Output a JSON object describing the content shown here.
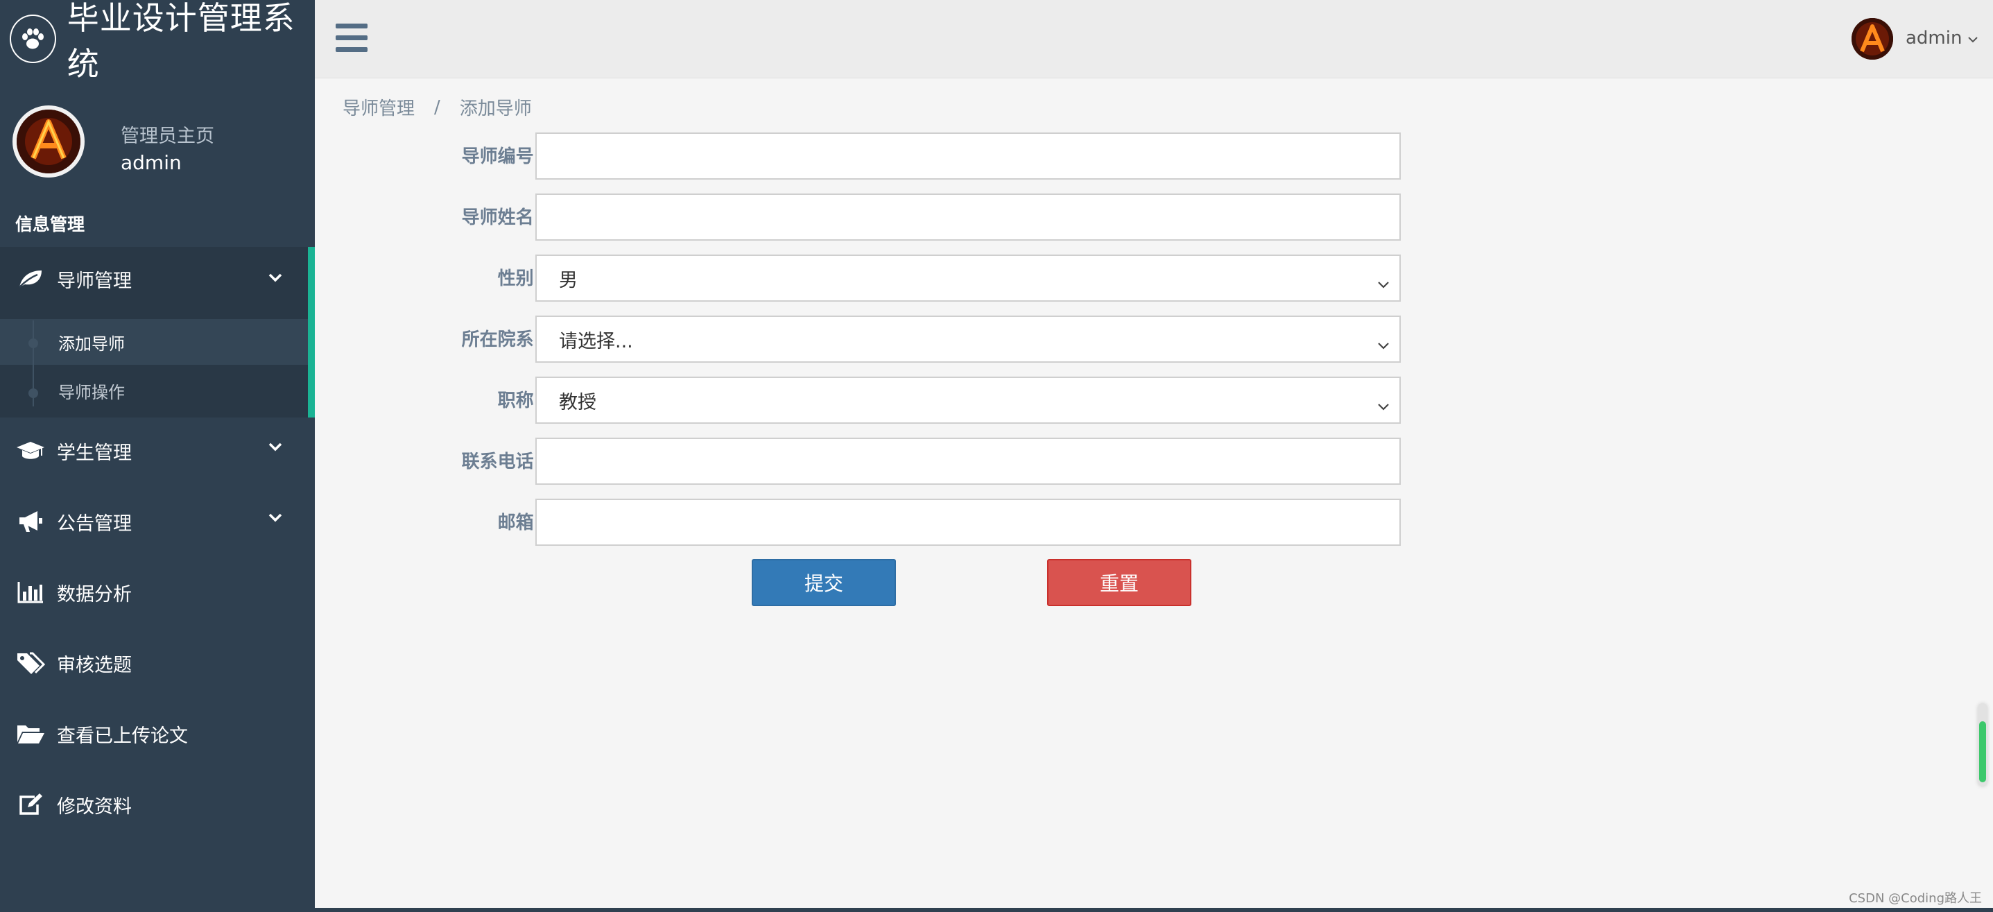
{
  "brand": {
    "title": "毕业设计管理系统",
    "logo_icon": "paw-icon"
  },
  "profile": {
    "role": "管理员主页",
    "name": "admin"
  },
  "sidebar": {
    "section_title": "信息管理",
    "items": [
      {
        "label": "导师管理",
        "icon": "leaf-icon",
        "expanded": true
      },
      {
        "label": "学生管理",
        "icon": "graduation-cap-icon",
        "expanded": false
      },
      {
        "label": "公告管理",
        "icon": "megaphone-icon",
        "expanded": false
      },
      {
        "label": "数据分析",
        "icon": "bar-chart-icon"
      },
      {
        "label": "审核选题",
        "icon": "tags-icon"
      },
      {
        "label": "查看已上传论文",
        "icon": "folder-open-icon"
      },
      {
        "label": "修改资料",
        "icon": "edit-icon"
      }
    ],
    "submenu": [
      {
        "label": "添加导师",
        "active": true
      },
      {
        "label": "导师操作",
        "active": false
      }
    ],
    "accent": "#1ab394",
    "background": "#2f4050"
  },
  "topbar": {
    "menu_icon": "hamburger-icon",
    "user": "admin"
  },
  "breadcrumb": {
    "parent": "导师管理",
    "separator": "/",
    "current": "添加导师"
  },
  "form": {
    "teacher_id": {
      "label": "导师编号:",
      "value": ""
    },
    "teacher_name": {
      "label": "导师姓名:",
      "value": ""
    },
    "gender": {
      "label": "性别:",
      "selected": "男"
    },
    "department": {
      "label": "所在院系:",
      "selected": "请选择..."
    },
    "title": {
      "label": "职称:",
      "selected": "教授"
    },
    "phone": {
      "label": "联系电话:",
      "value": ""
    },
    "email": {
      "label": "邮箱:",
      "value": ""
    },
    "submit_label": "提交",
    "reset_label": "重置",
    "submit_color": "#337ab7",
    "reset_color": "#d9534f"
  },
  "watermark": "CSDN @Coding路人王"
}
